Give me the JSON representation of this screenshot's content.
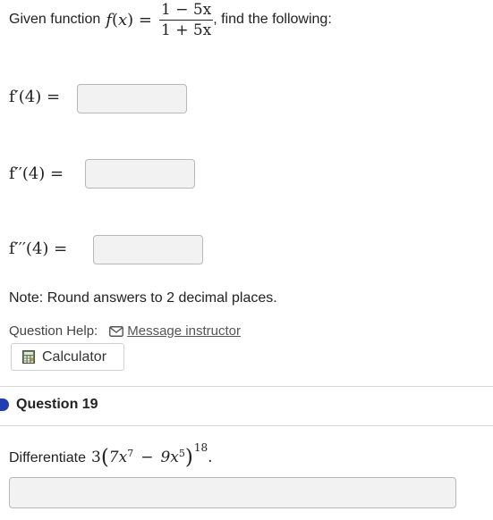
{
  "question_intro": {
    "prefix": "Given function",
    "func_name": "f",
    "var": "x",
    "numerator": "1 − 5x",
    "denominator": "1 + 5x",
    "suffix": ", find the following:"
  },
  "answers": [
    {
      "label": "f′(4) =",
      "value": ""
    },
    {
      "label": "f′′(4) =",
      "value": ""
    },
    {
      "label": "f′′′(4) =",
      "value": ""
    }
  ],
  "note": "Note: Round answers to 2 decimal places.",
  "help": {
    "label": "Question Help:",
    "message_link": "Message instructor",
    "calculator_label": "Calculator"
  },
  "question19": {
    "title": "Question 19",
    "prompt_prefix": "Differentiate",
    "coef": "3",
    "term1_coef": "7x",
    "term1_exp": "7",
    "minus": "−",
    "term2_coef": "9x",
    "term2_exp": "5",
    "outer_exp": "18",
    "answer_value": ""
  },
  "icons": {
    "message": "envelope-icon",
    "calculator": "calculator-icon",
    "question_marker": "filled-circle-icon"
  },
  "colors": {
    "question_marker": "#1f3fb0",
    "input_bg": "#f2f2f2"
  }
}
